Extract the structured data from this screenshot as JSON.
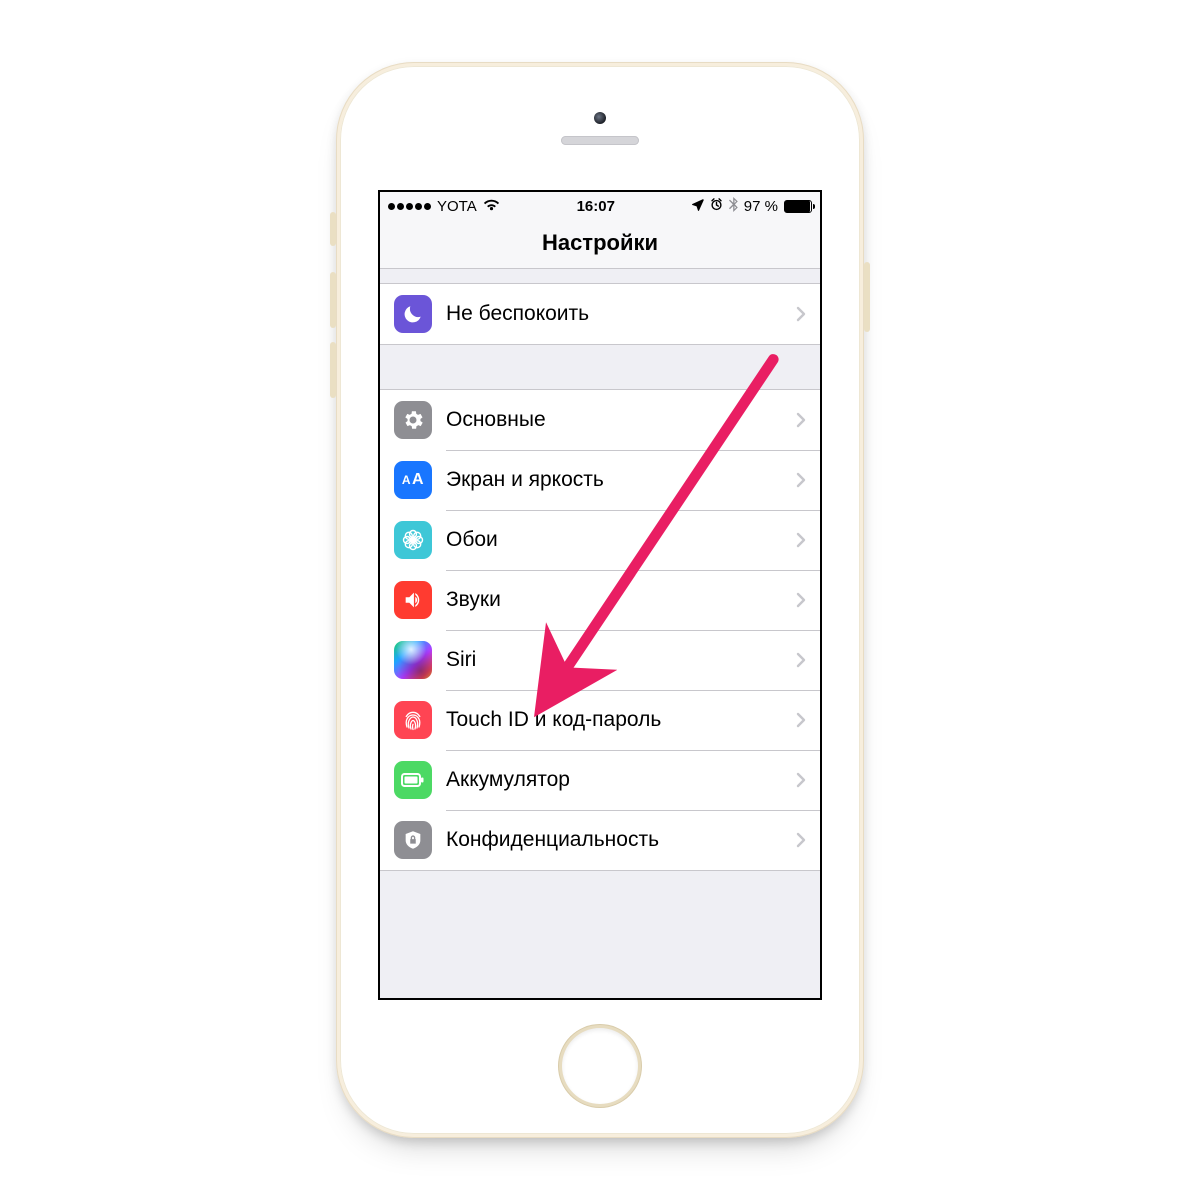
{
  "statusbar": {
    "carrier": "YOTA",
    "time": "16:07",
    "battery_pct": "97 %"
  },
  "nav": {
    "title": "Настройки"
  },
  "group_top": {
    "items": [
      {
        "label": "Не беспокоить",
        "icon_name": "moon-icon"
      }
    ]
  },
  "group_main": {
    "items": [
      {
        "label": "Основные",
        "icon_name": "gear-icon"
      },
      {
        "label": "Экран и яркость",
        "icon_name": "display-icon"
      },
      {
        "label": "Обои",
        "icon_name": "wallpaper-icon"
      },
      {
        "label": "Звуки",
        "icon_name": "sounds-icon"
      },
      {
        "label": "Siri",
        "icon_name": "siri-icon"
      },
      {
        "label": "Touch ID и код-пароль",
        "icon_name": "fingerprint-icon"
      },
      {
        "label": "Аккумулятор",
        "icon_name": "battery-icon"
      },
      {
        "label": "Конфиденциальность",
        "icon_name": "privacy-icon"
      }
    ]
  },
  "annotation": {
    "arrow_color": "#e91e63",
    "target_label": "Touch ID и код-пароль"
  }
}
